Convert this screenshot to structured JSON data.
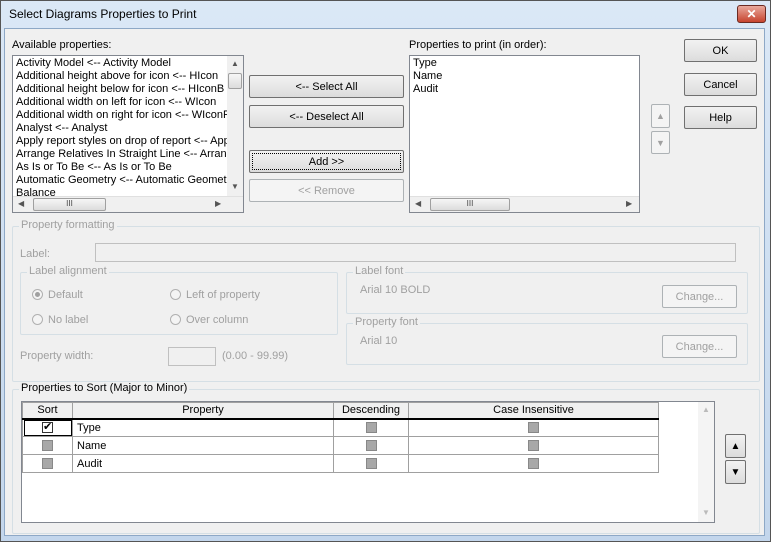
{
  "window": {
    "title": "Select Diagrams Properties to Print",
    "close_icon": "close-icon"
  },
  "available": {
    "label": "Available properties:",
    "items": [
      "Activity Model <-- Activity Model",
      "Additional height above for icon <-- HIcon",
      "Additional height below for icon <-- HIconB",
      "Additional width on left for icon <-- WIcon",
      "Additional width on right for icon <-- WIconR",
      "Analyst <-- Analyst",
      "Apply report styles on drop of report <-- Apply",
      "Arrange Relatives In Straight Line <-- Arrange",
      "As Is or To Be <-- As Is or To Be",
      "Automatic Geometry <-- Automatic Geometry",
      "Balance"
    ]
  },
  "middle": {
    "select_all": "<-- Select All",
    "deselect_all": "<-- Deselect All",
    "add": "Add >>",
    "remove": "<< Remove"
  },
  "to_print": {
    "label": "Properties to print (in order):",
    "items": [
      "Type",
      "Name",
      "Audit"
    ]
  },
  "dialog": {
    "ok": "OK",
    "cancel": "Cancel",
    "help": "Help",
    "up": "▲",
    "down": "▼"
  },
  "formatting": {
    "title": "Property formatting",
    "label": "Label:",
    "label_value": "",
    "alignment": {
      "title": "Label alignment",
      "options": [
        "Default",
        "Left of property",
        "No label",
        "Over column"
      ],
      "selected": "Default"
    },
    "width_label": "Property width:",
    "width_value": "",
    "width_range": "(0.00 - 99.99)",
    "label_font": {
      "title": "Label font",
      "value": "Arial 10 BOLD",
      "change": "Change..."
    },
    "property_font": {
      "title": "Property font",
      "value": "Arial 10",
      "change": "Change..."
    }
  },
  "sort": {
    "title": "Properties to Sort (Major to Minor)",
    "columns": [
      "Sort",
      "Property",
      "Descending",
      "Case Insensitive"
    ],
    "rows": [
      {
        "sort": true,
        "property": "Type",
        "descending": false,
        "case_insensitive": false
      },
      {
        "sort": false,
        "property": "Name",
        "descending": false,
        "case_insensitive": false
      },
      {
        "sort": false,
        "property": "Audit",
        "descending": false,
        "case_insensitive": false
      }
    ]
  }
}
